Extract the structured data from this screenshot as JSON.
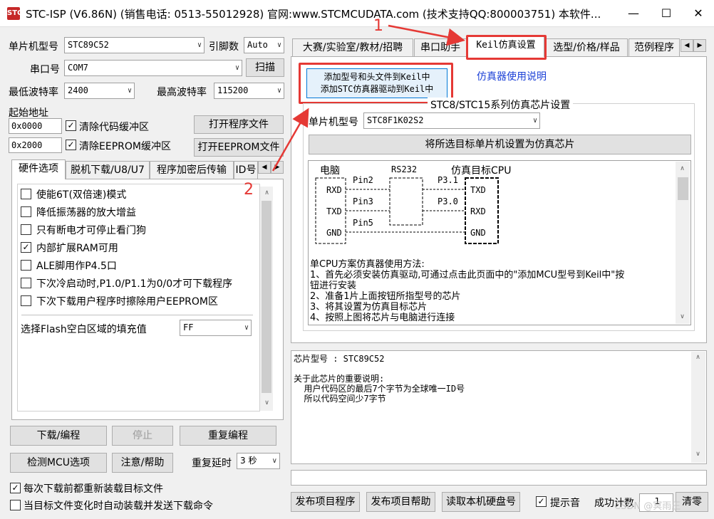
{
  "window": {
    "title": "STC-ISP (V6.86N) (销售电话: 0513-55012928) 官网:www.STCMCUDATA.com  (技术支持QQ:800003751) 本软件...",
    "app_icon": "STC",
    "controls": {
      "minimize": "—",
      "maximize": "☐",
      "close": "✕"
    }
  },
  "left": {
    "mcu_type_label": "单片机型号",
    "mcu_type_value": "STC89C52",
    "pins_label": "引脚数",
    "pins_value": "Auto",
    "com_label": "串口号",
    "com_value": "COM7",
    "scan_button": "扫描",
    "min_baud_label": "最低波特率",
    "min_baud_value": "2400",
    "max_baud_label": "最高波特率",
    "max_baud_value": "115200",
    "start_addr_label": "起始地址",
    "addr1": "0x0000",
    "clear_code_label": "清除代码缓冲区",
    "open_program_button": "打开程序文件",
    "addr2": "0x2000",
    "clear_eeprom_label": "清除EEPROM缓冲区",
    "open_eeprom_button": "打开EEPROM文件",
    "tabs": [
      "硬件选项",
      "脱机下载/U8/U7",
      "程序加密后传输",
      "ID号"
    ],
    "options": [
      {
        "label": "使能6T(双倍速)模式",
        "checked": false
      },
      {
        "label": "降低振荡器的放大增益",
        "checked": false
      },
      {
        "label": "只有断电才可停止看门狗",
        "checked": false
      },
      {
        "label": "内部扩展RAM可用",
        "checked": true
      },
      {
        "label": "ALE脚用作P4.5口",
        "checked": false
      },
      {
        "label": "下次冷启动时,P1.0/P1.1为0/0才可下载程序",
        "checked": false
      },
      {
        "label": "下次下载用户程序时擦除用户EEPROM区",
        "checked": false
      }
    ],
    "flash_fill_label": "选择Flash空白区域的填充值",
    "flash_fill_value": "FF",
    "download_button": "下载/编程",
    "stop_button": "停止",
    "reprogram_button": "重复编程",
    "check_mcu_button": "检测MCU选项",
    "help_button": "注意/帮助",
    "repeat_delay_label": "重复延时",
    "repeat_delay_value": "3 秒",
    "reload_label": "每次下载前都重新装载目标文件",
    "auto_send_label": "当目标文件变化时自动装载并发送下载命令"
  },
  "right": {
    "tabs": [
      "大赛/实验室/教材/招聘",
      "串口助手",
      "Keil仿真设置",
      "选型/价格/样品",
      "范例程序"
    ],
    "active_tab": "Keil仿真设置",
    "add_keil_button_line1": "添加型号和头文件到Keil中",
    "add_keil_button_line2": "添加STC仿真器驱动到Keil中",
    "emu_help_link": "仿真器使用说明",
    "group_title": "STC8/STC15系列仿真芯片设置",
    "mcu_type_label": "单片机型号",
    "mcu_type_value": "STC8F1K02S2",
    "set_emu_button": "将所选目标单片机设置为仿真芯片",
    "diagram": {
      "pc_label": "电脑",
      "rs232_label": "RS232",
      "target_label": "仿真目标CPU",
      "pc_pins": [
        "RXD",
        "TXD",
        "GND"
      ],
      "wire_labels": [
        "Pin2",
        "Pin3",
        "Pin5"
      ],
      "port_labels": [
        "P3.1",
        "P3.0"
      ],
      "cpu_pins": [
        "TXD",
        "RXD",
        "GND"
      ]
    },
    "instructions": [
      "单CPU方案仿真器使用方法:",
      "1、首先必须安装仿真驱动,可通过点击此页面中的\"添加MCU型号到Keil中\"按",
      "钮进行安装",
      "2、准备1片上面按钮所指型号的芯片",
      "3、将其设置为仿真目标芯片",
      "4、按照上图将芯片与电脑进行连接"
    ],
    "info_lines": [
      "芯片型号 : STC89C52",
      "",
      "关于此芯片的重要说明:",
      "  用户代码区的最后7个字节为全球唯一ID号",
      "  所以代码空间少7字节"
    ],
    "publish_program_button": "发布项目程序",
    "publish_help_button": "发布项目帮助",
    "read_disk_button": "读取本机硬盘号",
    "sound_label": "提示音",
    "success_count_label": "成功计数",
    "success_count_value": "1",
    "clear_button": "清零"
  },
  "annotations": {
    "marker1": "1",
    "marker2": "2",
    "color": "#e53935"
  },
  "watermark": "CSDN @冥雨王"
}
